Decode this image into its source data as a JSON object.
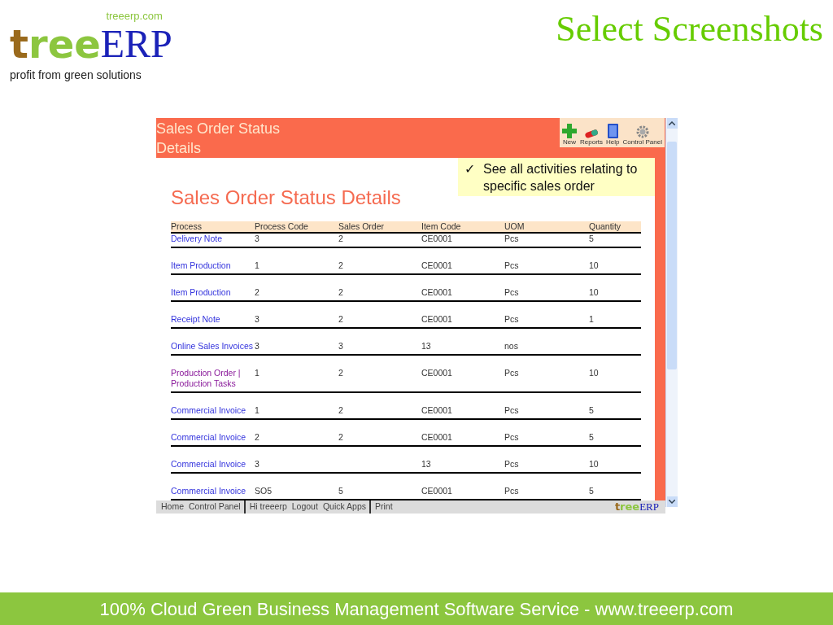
{
  "brand": {
    "site": "treeerp.com",
    "logo_tree": "tree",
    "logo_erp": "ERP",
    "tagline": "profit from green solutions"
  },
  "slide_title": "Select Screenshots",
  "app": {
    "title": "Sales Order Status Details",
    "toolbar": [
      {
        "label": "New",
        "kind": "new"
      },
      {
        "label": "Reports",
        "kind": "reports"
      },
      {
        "label": "Help",
        "kind": "help"
      },
      {
        "label": "Control Panel",
        "kind": "settings"
      }
    ],
    "callout": {
      "mark": "✓",
      "text": "See all activities relating to specific sales order"
    },
    "heading": "Sales Order Status Details",
    "table": {
      "columns": [
        "Process",
        "Process Code",
        "Sales Order",
        "Item Code",
        "UOM",
        "Quantity"
      ],
      "rows": [
        {
          "visited": false,
          "cells": [
            "Delivery Note",
            "3",
            "2",
            "CE0001",
            "Pcs",
            "5"
          ]
        },
        {
          "visited": false,
          "cells": [
            "Item Production",
            "1",
            "2",
            "CE0001",
            "Pcs",
            "10"
          ]
        },
        {
          "visited": false,
          "cells": [
            "Item Production",
            "2",
            "2",
            "CE0001",
            "Pcs",
            "10"
          ]
        },
        {
          "visited": false,
          "cells": [
            "Receipt Note",
            "3",
            "2",
            "CE0001",
            "Pcs",
            "1"
          ]
        },
        {
          "visited": false,
          "cells": [
            "Online Sales Invoices",
            "3",
            "3",
            "13",
            "nos",
            ""
          ]
        },
        {
          "visited": true,
          "cells": [
            "Production Order | Production Tasks",
            "1",
            "2",
            "CE0001",
            "Pcs",
            "10"
          ]
        },
        {
          "visited": false,
          "cells": [
            "Commercial Invoice",
            "1",
            "2",
            "CE0001",
            "Pcs",
            "5"
          ]
        },
        {
          "visited": false,
          "cells": [
            "Commercial Invoice",
            "2",
            "2",
            "CE0001",
            "Pcs",
            "5"
          ]
        },
        {
          "visited": false,
          "cells": [
            "Commercial Invoice",
            "3",
            "",
            "13",
            "Pcs",
            "10"
          ]
        },
        {
          "visited": false,
          "cells": [
            "Commercial Invoice",
            "SO5",
            "5",
            "CE0001",
            "Pcs",
            "5"
          ]
        }
      ]
    },
    "footer_links": [
      [
        "Home",
        "Control Panel"
      ],
      [
        "Hi treeerp",
        "Logout",
        "Quick Apps"
      ],
      [
        "Print"
      ]
    ],
    "footer_logo": {
      "tree": "tree",
      "erp": "ERP"
    }
  },
  "banner": "100% Cloud Green Business Management Software Service - www.treeerp.com"
}
